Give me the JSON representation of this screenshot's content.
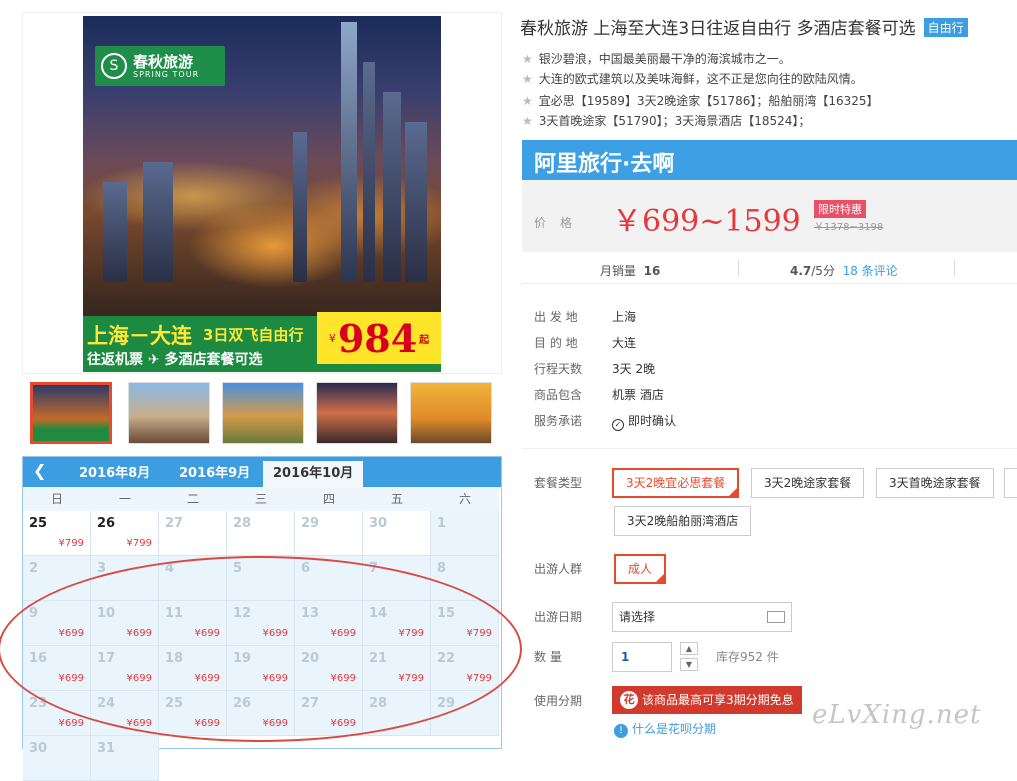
{
  "product": {
    "title": "春秋旅游 上海至大连3日往返自由行 多酒店套餐可选",
    "tag": "自由行",
    "features": [
      "银沙碧浪，中国最美丽最干净的海滨城市之一。",
      "大连的欧式建筑以及美味海鲜，这不正是您向往的欧陆风情。",
      "宜必思【19589】3天2晚途家【51786】；船舶丽湾【16325】",
      "3天首晚途家【51790】；3天海景酒店【18524】；"
    ]
  },
  "banner": {
    "logo_cn": "春秋旅游",
    "logo_en": "SPRING TOUR",
    "line1": "上海－大连",
    "line1b": "3日双飞自由行",
    "line2": "往返机票  ✈  多酒店套餐可选",
    "yen": "¥",
    "price": "984",
    "qi": "起"
  },
  "ali": {
    "title": "阿里旅行·去啊"
  },
  "price": {
    "label": "价格",
    "value": "￥699~1599",
    "badge": "限时特惠",
    "original": "￥1378~3198"
  },
  "stats": {
    "sales_label": "月销量",
    "sales": "16",
    "rating": "4.7",
    "rating_unit": "/5分",
    "reviews": "18 条评论"
  },
  "details": [
    {
      "label": "出 发 地",
      "value": "上海"
    },
    {
      "label": "目 的 地",
      "value": "大连"
    },
    {
      "label": "行程天数",
      "value": "3天 2晚"
    },
    {
      "label": "商品包含",
      "value": "机票   酒店"
    },
    {
      "label": "服务承诺",
      "value": "即时确认"
    }
  ],
  "package": {
    "label": "套餐类型",
    "options": [
      "3天2晚宜必思套餐",
      "3天2晚途家套餐",
      "3天首晚途家套餐",
      "3天2晚船舶丽湾酒店"
    ]
  },
  "people": {
    "label": "出游人群",
    "option": "成人"
  },
  "date": {
    "label": "出游日期",
    "placeholder": "请选择"
  },
  "quantity": {
    "label": "数   量",
    "value": "1",
    "stock": "库存952 件"
  },
  "installment": {
    "label": "使用分期",
    "banner": "该商品最高可享3期分期免息",
    "what": "什么是花呗分期"
  },
  "calendar": {
    "tabs": [
      "2016年8月",
      "2016年9月",
      "2016年10月"
    ],
    "active_tab": 2,
    "weekdays": [
      "日",
      "一",
      "二",
      "三",
      "四",
      "五",
      "六"
    ],
    "rows": [
      [
        {
          "d": "25",
          "p": "¥799"
        },
        {
          "d": "26",
          "p": "¥799"
        },
        {
          "d": "27",
          "p": "",
          "dim": true
        },
        {
          "d": "28",
          "p": "",
          "dim": true
        },
        {
          "d": "29",
          "p": "",
          "dim": true
        },
        {
          "d": "30",
          "p": "",
          "dim": true
        },
        {
          "d": "1",
          "p": "",
          "dim": true,
          "blue": true
        }
      ],
      [
        {
          "d": "2",
          "p": "",
          "dim": true,
          "blue": true
        },
        {
          "d": "3",
          "p": "",
          "dim": true,
          "blue": true
        },
        {
          "d": "4",
          "p": "",
          "dim": true,
          "blue": true
        },
        {
          "d": "5",
          "p": "",
          "dim": true,
          "blue": true
        },
        {
          "d": "6",
          "p": "",
          "dim": true,
          "blue": true
        },
        {
          "d": "7",
          "p": "",
          "dim": true,
          "blue": true
        },
        {
          "d": "8",
          "p": "",
          "dim": true,
          "blue": true
        }
      ],
      [
        {
          "d": "9",
          "p": "¥699",
          "blue": true
        },
        {
          "d": "10",
          "p": "¥699",
          "blue": true
        },
        {
          "d": "11",
          "p": "¥699",
          "blue": true
        },
        {
          "d": "12",
          "p": "¥699",
          "blue": true
        },
        {
          "d": "13",
          "p": "¥699",
          "blue": true
        },
        {
          "d": "14",
          "p": "¥799",
          "blue": true
        },
        {
          "d": "15",
          "p": "¥799",
          "blue": true
        }
      ],
      [
        {
          "d": "16",
          "p": "¥699",
          "blue": true
        },
        {
          "d": "17",
          "p": "¥699",
          "blue": true
        },
        {
          "d": "18",
          "p": "¥699",
          "blue": true
        },
        {
          "d": "19",
          "p": "¥699",
          "blue": true
        },
        {
          "d": "20",
          "p": "¥699",
          "blue": true
        },
        {
          "d": "21",
          "p": "¥799",
          "blue": true
        },
        {
          "d": "22",
          "p": "¥799",
          "blue": true
        }
      ],
      [
        {
          "d": "23",
          "p": "¥699",
          "blue": true
        },
        {
          "d": "24",
          "p": "¥699",
          "blue": true
        },
        {
          "d": "25",
          "p": "¥699",
          "blue": true
        },
        {
          "d": "26",
          "p": "¥699",
          "blue": true
        },
        {
          "d": "27",
          "p": "¥699",
          "blue": true
        },
        {
          "d": "28",
          "p": "",
          "dim": true,
          "blue": true
        },
        {
          "d": "29",
          "p": "",
          "dim": true,
          "blue": true
        }
      ],
      [
        {
          "d": "30",
          "p": "",
          "dim": true,
          "blue": true
        },
        {
          "d": "31",
          "p": "",
          "dim": true,
          "blue": true
        }
      ]
    ]
  },
  "watermark": "eLvXing.net"
}
